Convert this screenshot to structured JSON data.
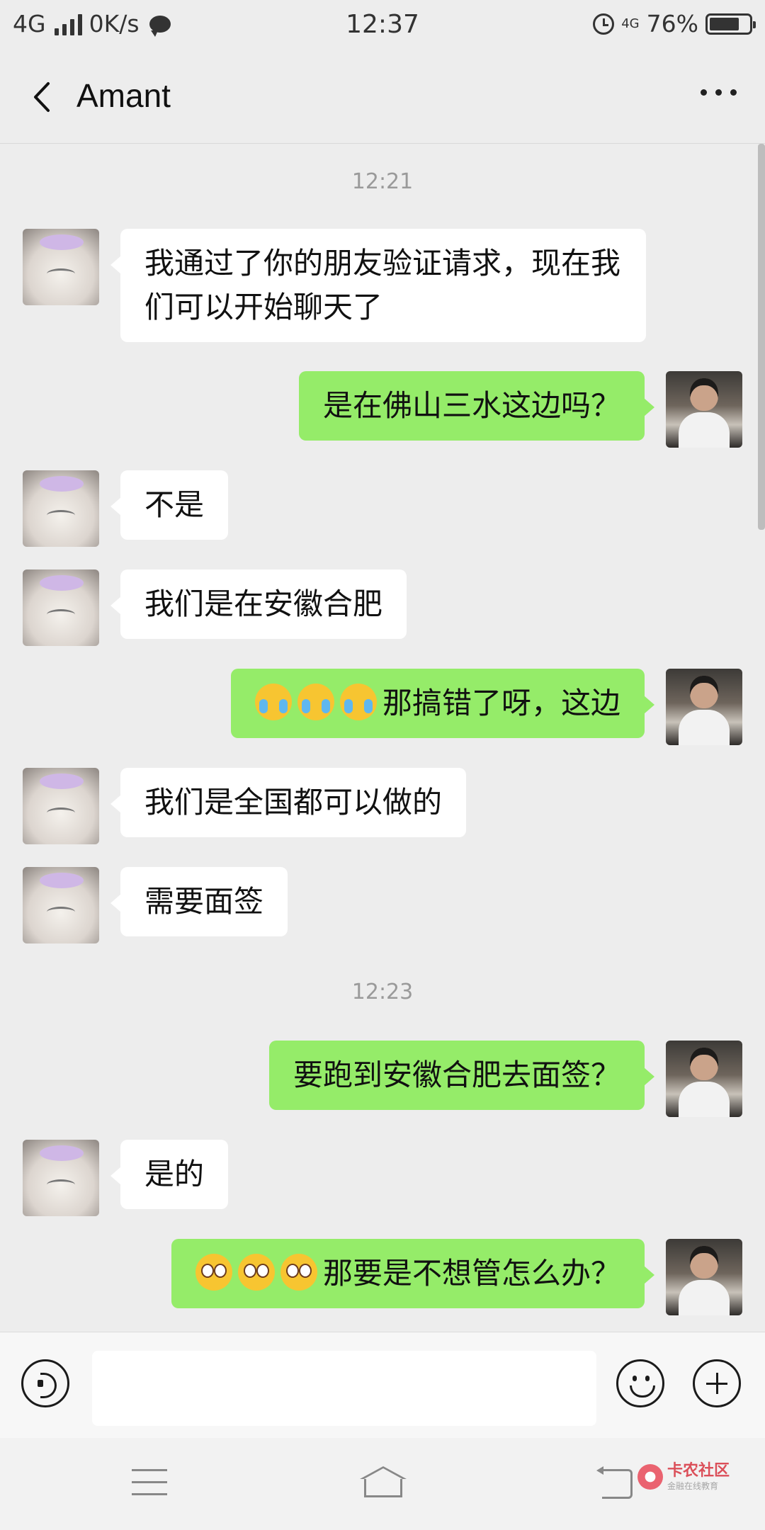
{
  "status_bar": {
    "network": "4G",
    "speed": "0K/s",
    "time": "12:37",
    "net_small": "4G",
    "battery": "76%",
    "battery_level": 0.76
  },
  "header": {
    "title": "Amant"
  },
  "messages": [
    {
      "type": "time",
      "text": "12:21"
    },
    {
      "type": "in",
      "text": "我通过了你的朋友验证请求，现在我们可以开始聊天了"
    },
    {
      "type": "out",
      "text": "是在佛山三水这边吗？"
    },
    {
      "type": "in",
      "text": "不是"
    },
    {
      "type": "in",
      "text": "我们是在安徽合肥"
    },
    {
      "type": "out",
      "emoji": "cry",
      "emoji_count": 3,
      "text": "那搞错了呀，这边"
    },
    {
      "type": "in",
      "text": "我们是全国都可以做的"
    },
    {
      "type": "in",
      "text": "需要面签"
    },
    {
      "type": "time",
      "text": "12:23"
    },
    {
      "type": "out",
      "text": "要跑到安徽合肥去面签？"
    },
    {
      "type": "in",
      "text": "是的"
    },
    {
      "type": "out",
      "emoji": "flushed",
      "emoji_count": 3,
      "text": "那要是不想管怎么办？"
    }
  ],
  "input": {
    "value": "",
    "placeholder": ""
  },
  "icons": {
    "back": "chevron-left-icon",
    "more": "more-horizontal-icon",
    "voice": "voice-icon",
    "emoji": "emoji-icon",
    "plus": "plus-icon"
  },
  "watermark": {
    "main": "卡农社区",
    "sub": "金融在线教育"
  },
  "colors": {
    "outgoing_bubble": "#95ec69",
    "incoming_bubble": "#ffffff",
    "background": "#ededed"
  }
}
